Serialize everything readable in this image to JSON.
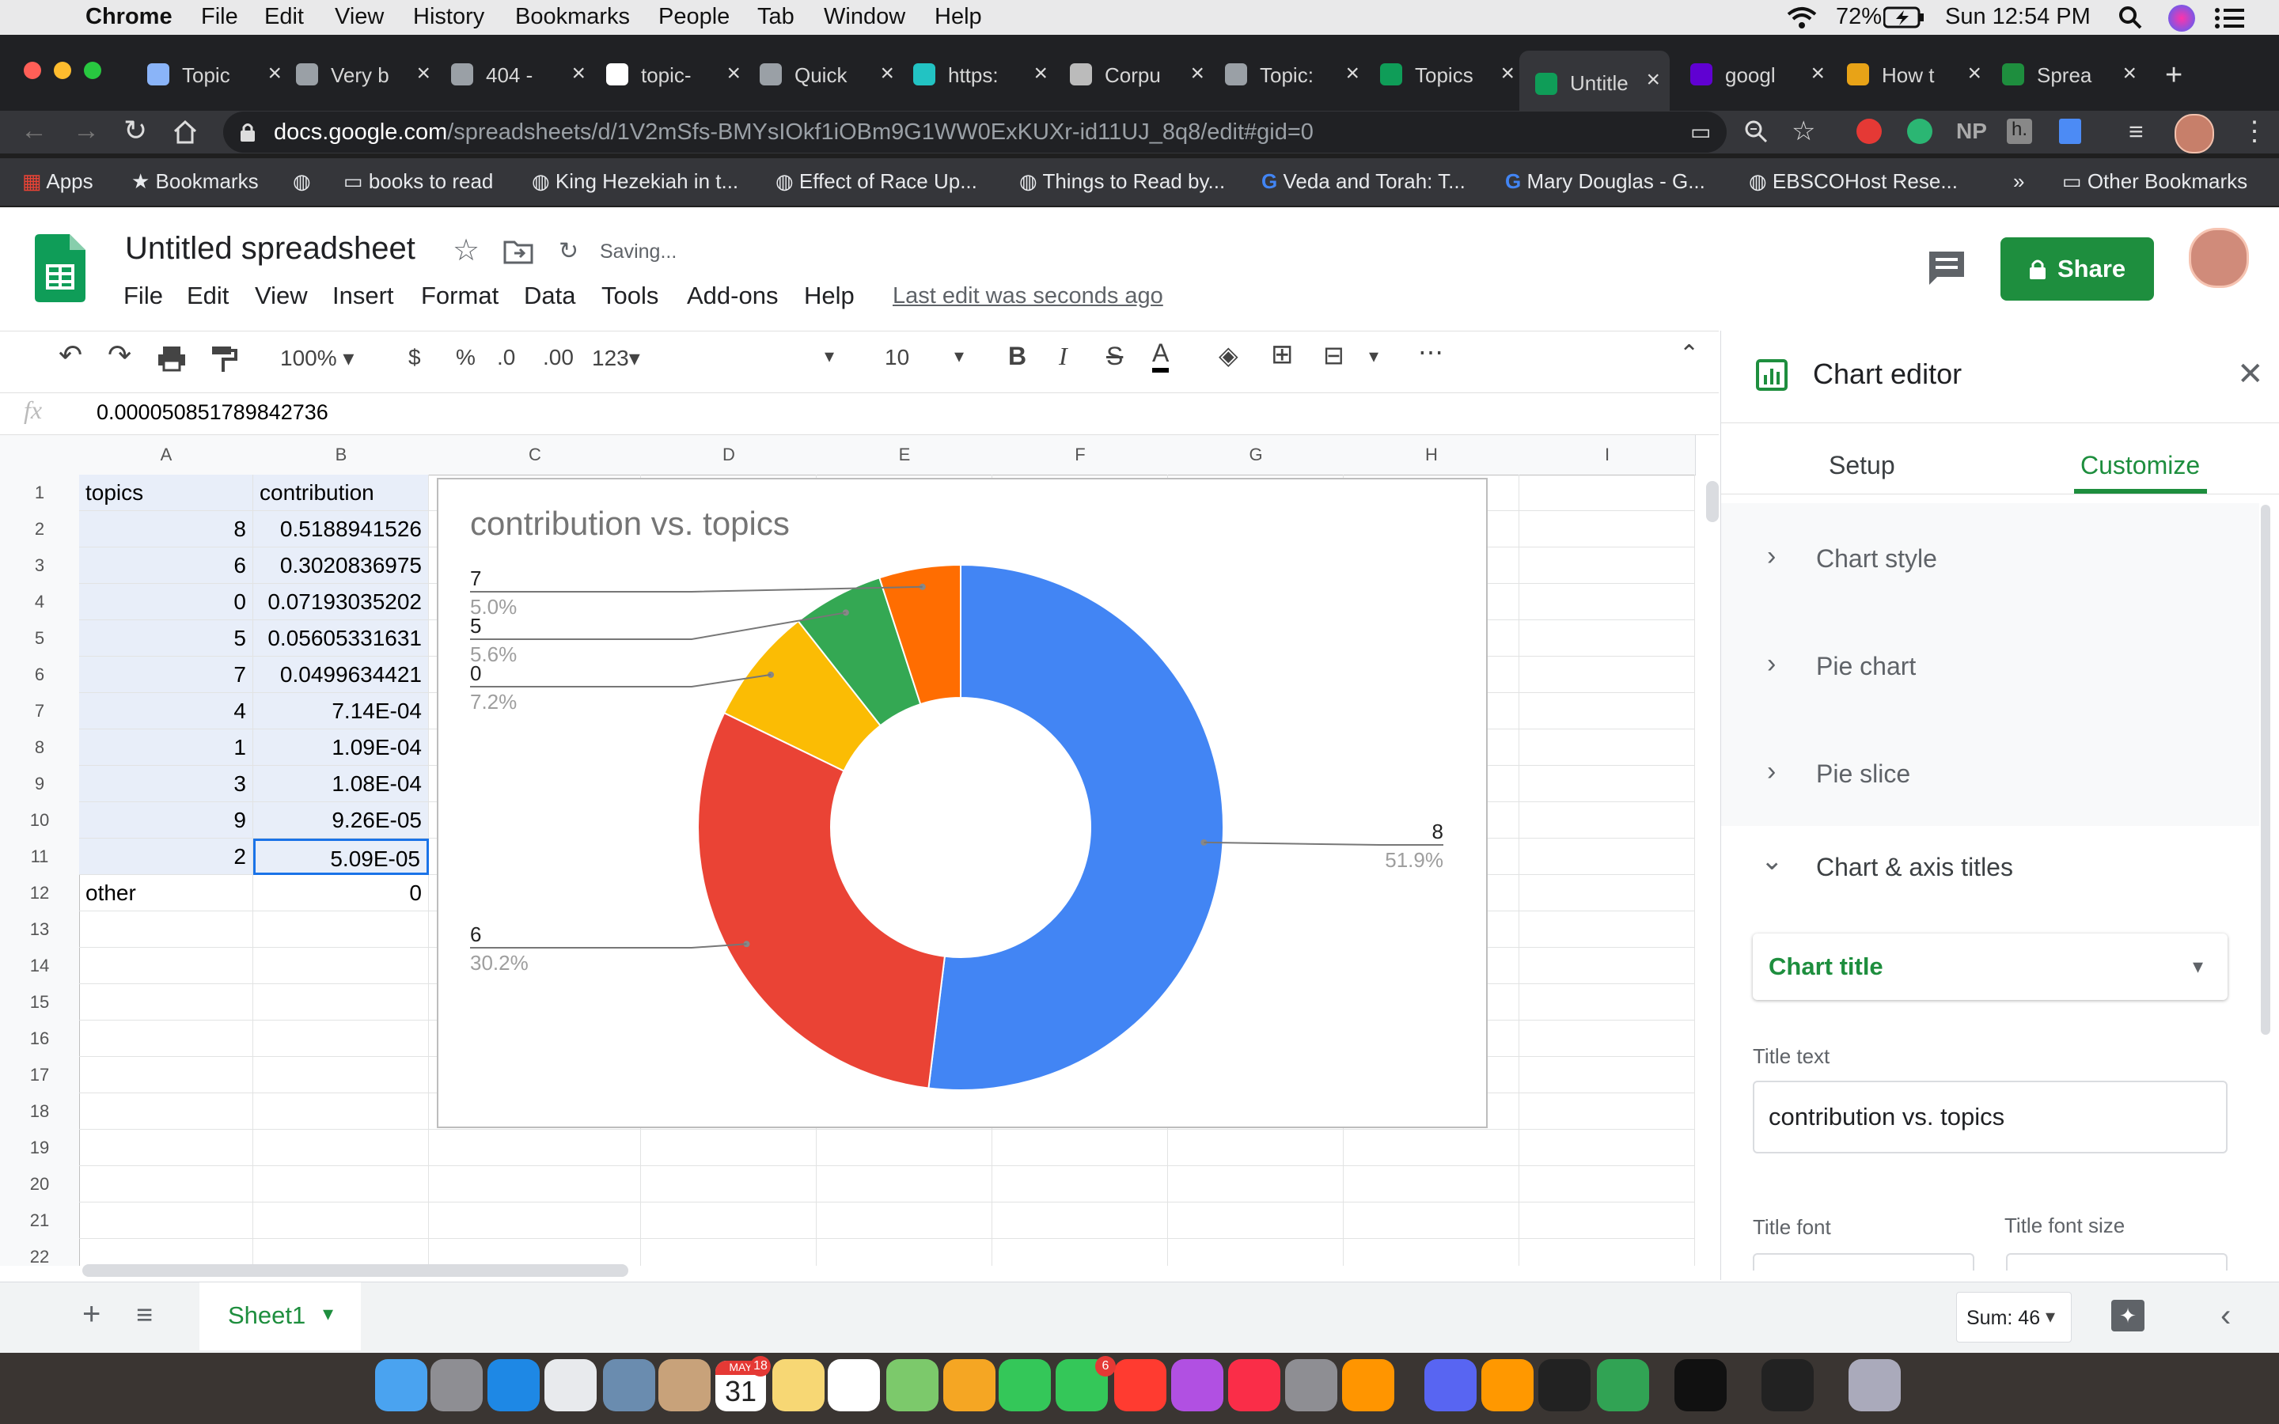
{
  "mac_menubar": {
    "app": "Chrome",
    "items": [
      "File",
      "Edit",
      "View",
      "History",
      "Bookmarks",
      "People",
      "Tab",
      "Window",
      "Help"
    ],
    "battery": "72%",
    "clock": "Sun 12:54 PM"
  },
  "tabs": [
    {
      "label": "Topic",
      "icon_color": "#8ab4f8"
    },
    {
      "label": "Very b",
      "icon_color": "#9aa0a6"
    },
    {
      "label": "404 -",
      "icon_color": "#9aa0a6"
    },
    {
      "label": "topic-",
      "icon_color": "#ffffff"
    },
    {
      "label": "Quick",
      "icon_color": "#9aa0a6"
    },
    {
      "label": "https:",
      "icon_color": "#22c3c3"
    },
    {
      "label": "Corpu",
      "icon_color": "#bbbbbb"
    },
    {
      "label": "Topic:",
      "icon_color": "#9aa0a6"
    },
    {
      "label": "Topics",
      "icon_color": "#0f9d58"
    },
    {
      "label": "Untitle",
      "icon_color": "#0f9d58"
    },
    {
      "label": "googl",
      "icon_color": "#6001d2"
    },
    {
      "label": "How t",
      "icon_color": "#e8a317"
    },
    {
      "label": "Sprea",
      "icon_color": "#1e8e3e"
    }
  ],
  "address": {
    "host": "docs.google.com",
    "path": "/spreadsheets/d/1V2mSfs-BMYsIOkf1iOBm9G1WW0ExKUXr-id11UJ_8q8/edit#gid=0"
  },
  "bookmarks": [
    "Apps",
    "Bookmarks",
    "books to read",
    "King Hezekiah in t...",
    "Effect of Race Up...",
    "Things to Read by...",
    "Veda and Torah: T...",
    "Mary Douglas - G...",
    "EBSCOHost Rese...",
    "»",
    "Other Bookmarks"
  ],
  "doc": {
    "title": "Untitled spreadsheet",
    "status": "Saving...",
    "menus": [
      "File",
      "Edit",
      "View",
      "Insert",
      "Format",
      "Data",
      "Tools",
      "Add-ons",
      "Help"
    ],
    "last_edit": "Last edit was seconds ago",
    "share": "Share"
  },
  "toolbar": {
    "zoom": "100%",
    "currency": "$",
    "percent": "%",
    "dec_less": ".0",
    "dec_more": ".00",
    "format": "123",
    "font_size": "10",
    "bold": "B",
    "italic": "I",
    "strike": "S",
    "text_color": "A"
  },
  "formula_bar": {
    "fx": "fx",
    "value": "0.000050851789842736"
  },
  "grid": {
    "columns": [
      "A",
      "B",
      "C",
      "D",
      "E",
      "F",
      "G",
      "H",
      "I"
    ],
    "rows": [
      [
        "topics",
        "contribution"
      ],
      [
        "8",
        "0.5188941526"
      ],
      [
        "6",
        "0.3020836975"
      ],
      [
        "0",
        "0.07193035202"
      ],
      [
        "5",
        "0.05605331631"
      ],
      [
        "7",
        "0.0499634421"
      ],
      [
        "4",
        "7.14E-04"
      ],
      [
        "1",
        "1.09E-04"
      ],
      [
        "3",
        "1.08E-04"
      ],
      [
        "9",
        "9.26E-05"
      ],
      [
        "2",
        "5.09E-05"
      ],
      [
        "other",
        "0"
      ],
      [
        "",
        ""
      ],
      [
        "",
        ""
      ],
      [
        "",
        ""
      ],
      [
        "",
        ""
      ],
      [
        "",
        ""
      ],
      [
        "",
        ""
      ],
      [
        "",
        ""
      ],
      [
        "",
        ""
      ],
      [
        "",
        ""
      ],
      [
        "",
        ""
      ]
    ],
    "row_numbers": [
      "1",
      "2",
      "3",
      "4",
      "5",
      "6",
      "7",
      "8",
      "9",
      "10",
      "11",
      "12",
      "13",
      "14",
      "15",
      "16",
      "17",
      "18",
      "19",
      "20",
      "21",
      "22"
    ]
  },
  "chart_data": {
    "type": "pie",
    "donut": true,
    "title": "contribution vs. topics",
    "slices": [
      {
        "label": "8",
        "value": 51.9,
        "pct": "51.9%",
        "color": "#4285f4"
      },
      {
        "label": "6",
        "value": 30.2,
        "pct": "30.2%",
        "color": "#ea4335"
      },
      {
        "label": "0",
        "value": 7.2,
        "pct": "7.2%",
        "color": "#fbbc04"
      },
      {
        "label": "5",
        "value": 5.6,
        "pct": "5.6%",
        "color": "#34a853"
      },
      {
        "label": "7",
        "value": 5.0,
        "pct": "5.0%",
        "color": "#ff6d01"
      }
    ]
  },
  "editor": {
    "title": "Chart editor",
    "tab_setup": "Setup",
    "tab_customize": "Customize",
    "sections": [
      "Chart style",
      "Pie chart",
      "Pie slice",
      "Chart & axis titles"
    ],
    "dropdown": "Chart title",
    "title_text_label": "Title text",
    "title_text_value": "contribution vs. topics",
    "title_font_label": "Title font",
    "title_font_size_label": "Title font size"
  },
  "sheetbar": {
    "sheet_name": "Sheet1",
    "sum": "Sum: 46"
  },
  "dock": {
    "calendar_month": "MAY",
    "calendar_day": "31",
    "badge_cal": "18",
    "badge_facetime": "6"
  }
}
